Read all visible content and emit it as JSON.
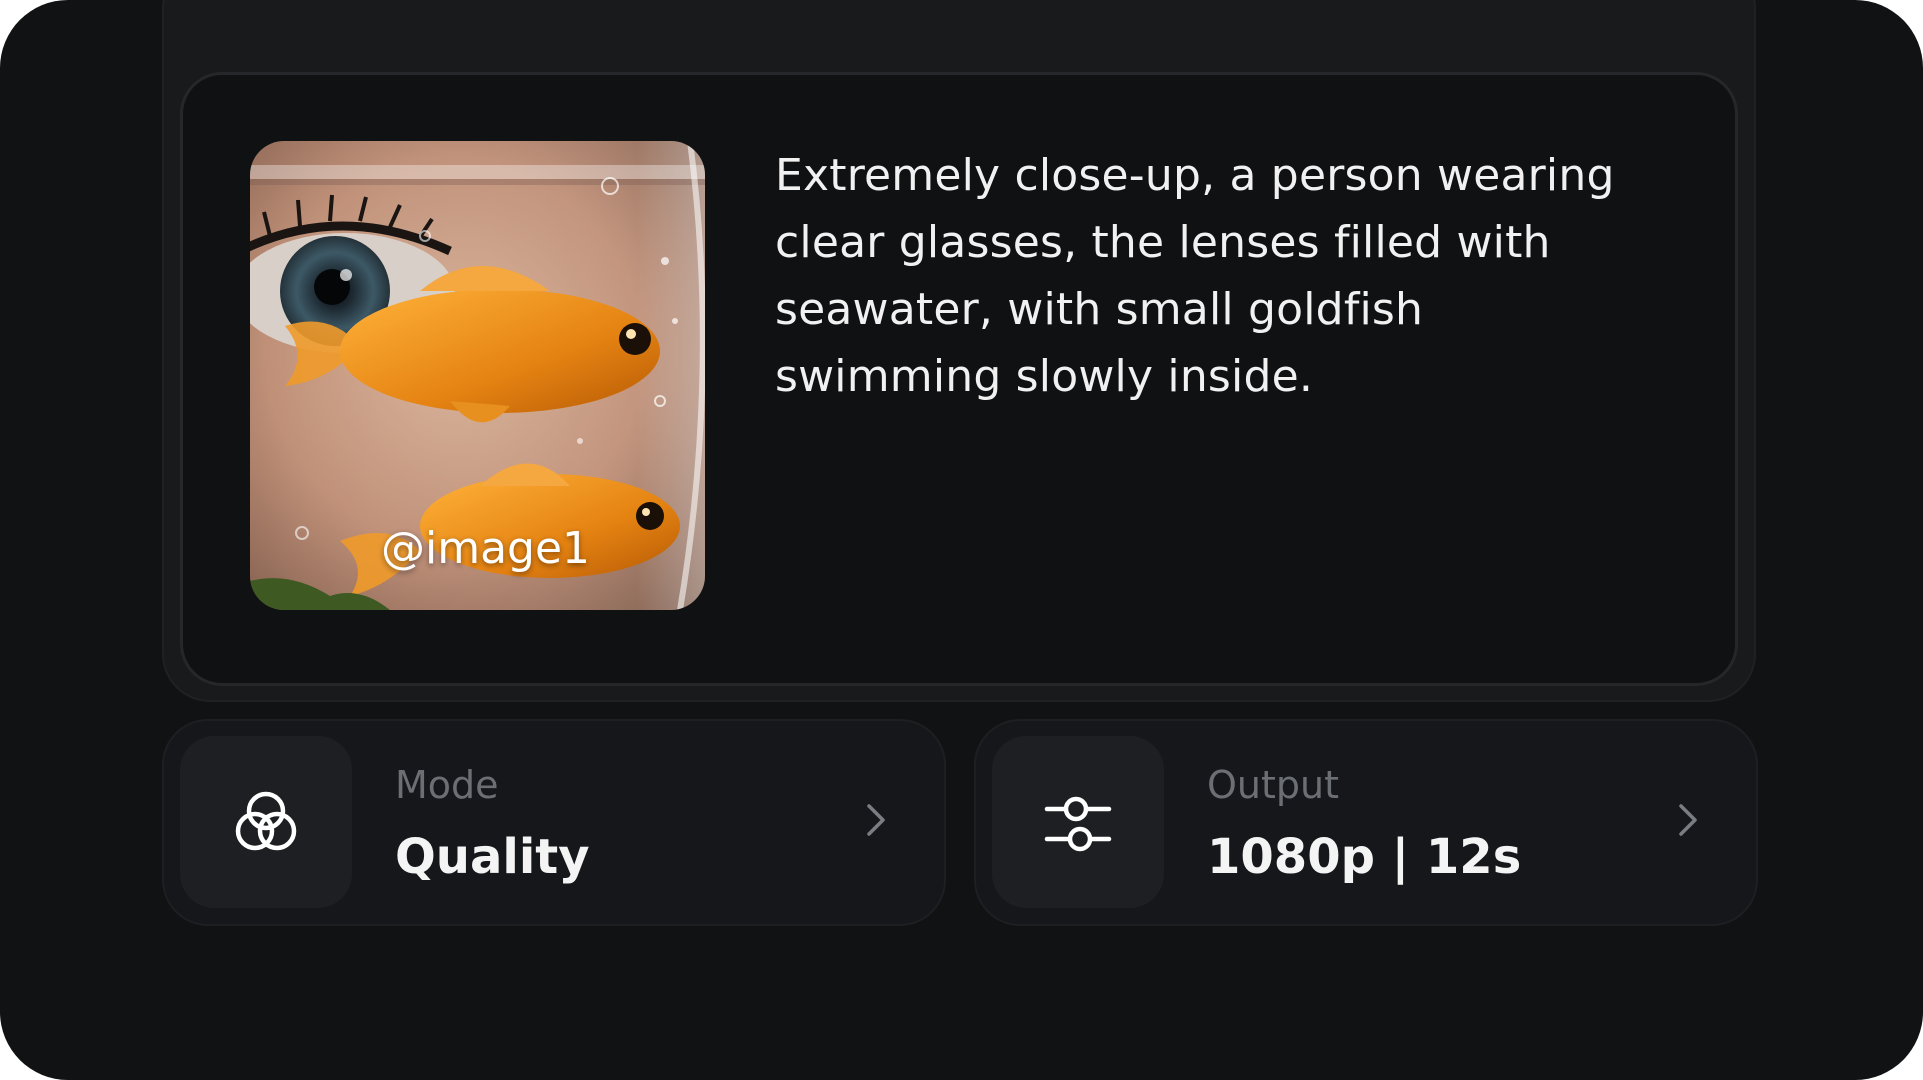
{
  "prompt": {
    "reference_tag": "@image1",
    "text": "Extremely close-up, a person wearing clear glasses, the lenses filled with seawater, with small goldfish swimming slowly inside."
  },
  "settings": {
    "mode": {
      "label": "Mode",
      "value": "Quality",
      "icon": "three-circles-icon"
    },
    "output": {
      "label": "Output",
      "value": "1080p | 12s",
      "icon": "sliders-icon"
    }
  },
  "colors": {
    "background": "#111213",
    "card": "#101113",
    "tile": "#1d1f23",
    "muted_text": "#6b6e73",
    "text": "#f1f1f1"
  }
}
